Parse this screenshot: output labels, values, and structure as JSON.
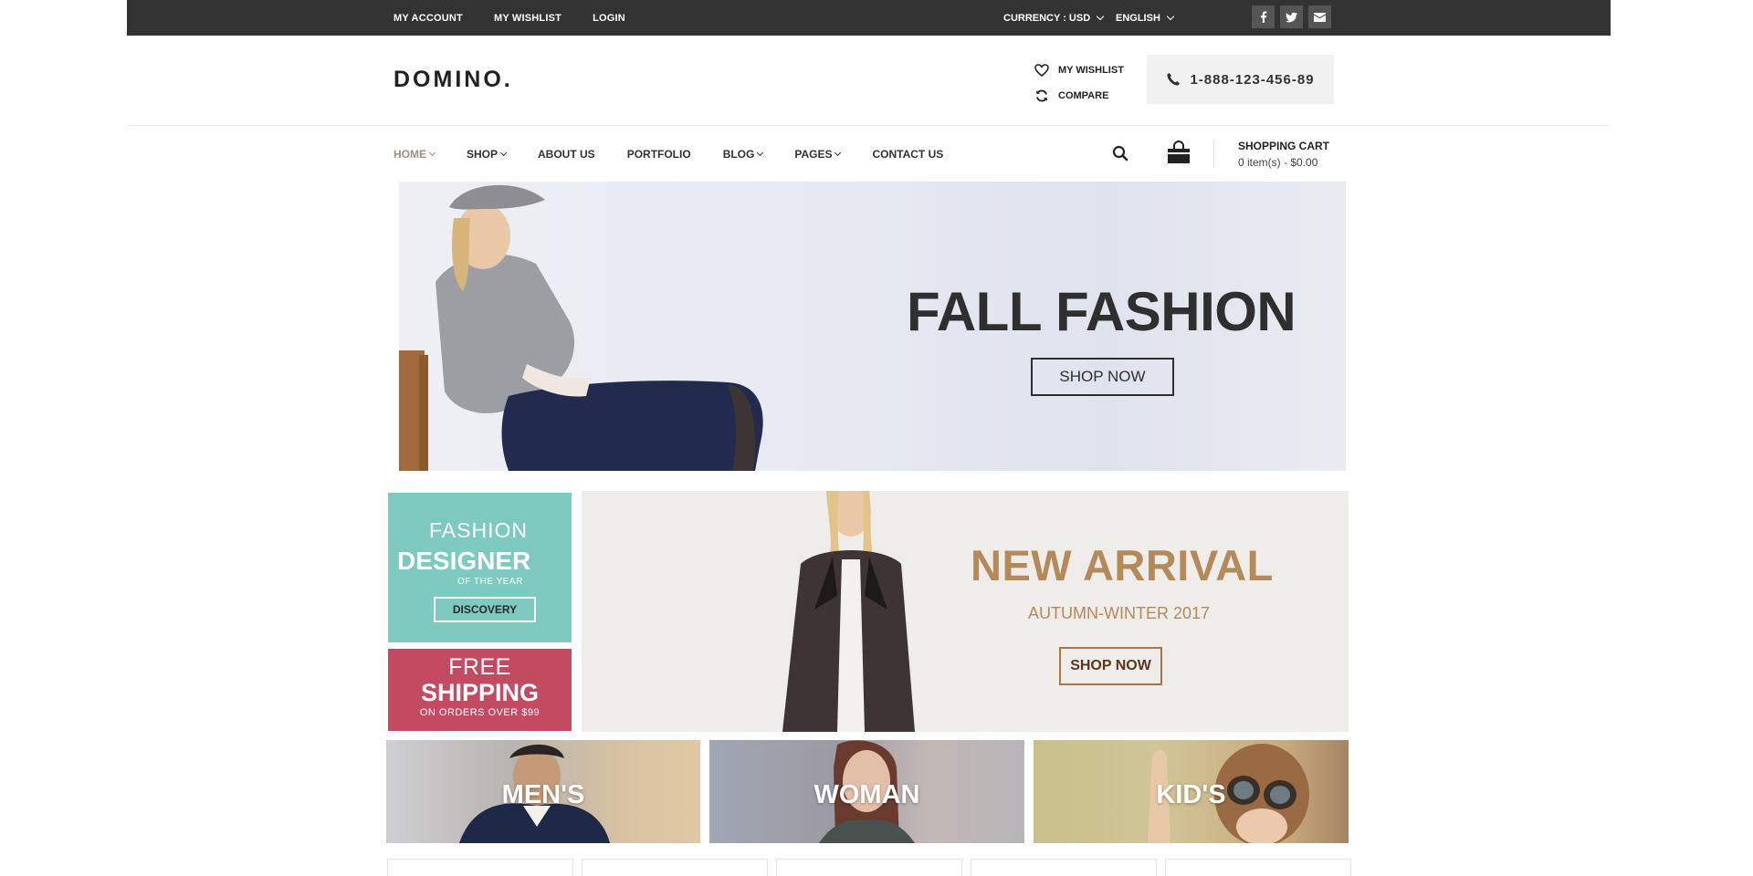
{
  "topbar": {
    "links": [
      "MY ACCOUNT",
      "MY WISHLIST",
      "LOGIN"
    ],
    "currency": "CURRENCY : USD",
    "language": "ENGLISH",
    "social_icons": [
      "facebook-icon",
      "twitter-icon",
      "envelope-icon"
    ],
    "bg_color": "#333333"
  },
  "header": {
    "logo": "DOMINO.",
    "wishlist_label": "MY WISHLIST",
    "compare_label": "COMPARE",
    "phone": "1-888-123-456-89"
  },
  "nav": {
    "items": [
      {
        "label": "HOME",
        "dropdown": true,
        "active": true
      },
      {
        "label": "SHOP",
        "dropdown": true
      },
      {
        "label": "ABOUT US",
        "dropdown": false
      },
      {
        "label": "PORTFOLIO",
        "dropdown": false
      },
      {
        "label": "BLOG",
        "dropdown": true
      },
      {
        "label": "PAGES",
        "dropdown": true
      },
      {
        "label": "CONTACT US",
        "dropdown": false
      }
    ],
    "active_color": "#a38f7e"
  },
  "cart": {
    "title": "SHOPPING CART",
    "summary": "0 item(s)  - $0.00"
  },
  "hero": {
    "title": "FALL FASHION",
    "button": "SHOP NOW"
  },
  "promo_designer": {
    "line1": "FASHION",
    "line2": "DESIGNER",
    "line3": "OF THE YEAR",
    "button": "DISCOVERY",
    "color": "#7ecac1"
  },
  "promo_shipping": {
    "line1": "FREE",
    "line2": "SHIPPING",
    "line3": "ON ORDERS OVER $99",
    "color": "#c44a62"
  },
  "arrival": {
    "title": "NEW ARRIVAL",
    "subtitle": "AUTUMN-WINTER 2017",
    "button": "SHOP NOW",
    "accent": "#b48a5a"
  },
  "categories": [
    "MEN'S",
    "WOMAN",
    "KID'S"
  ]
}
